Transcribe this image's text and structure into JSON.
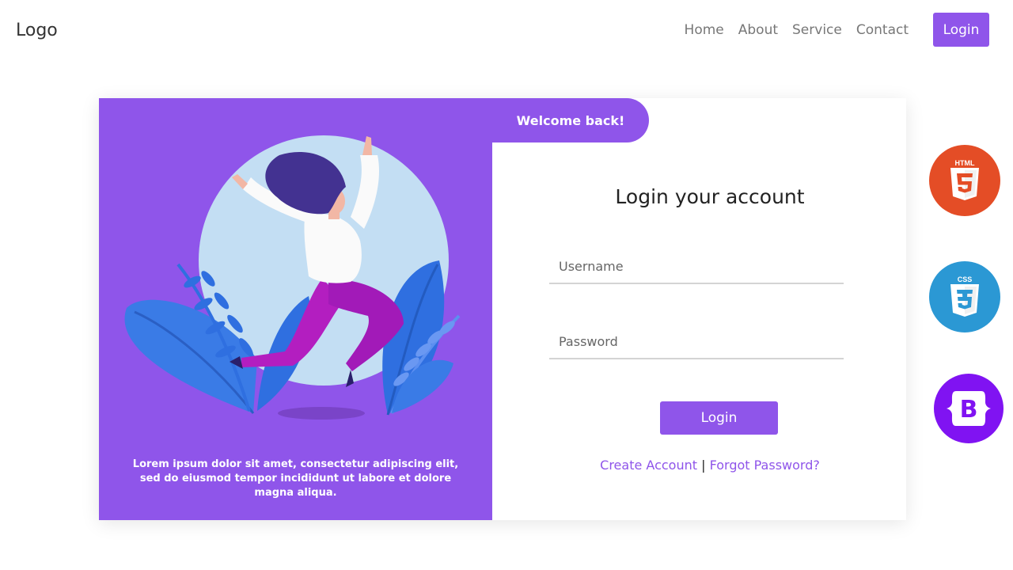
{
  "nav": {
    "logo": "Logo",
    "links": [
      "Home",
      "About",
      "Service",
      "Contact"
    ],
    "login_label": "Login"
  },
  "card": {
    "caption": "Lorem ipsum dolor sit amet, consectetur adipiscing elit, sed do eiusmod tempor incididunt ut labore et dolore magna aliqua.",
    "welcome": "Welcome back!",
    "title": "Login your account",
    "username_placeholder": "Username",
    "password_placeholder": "Password",
    "submit_label": "Login",
    "create_account": "Create Account",
    "separator": "|",
    "forgot_password": "Forgot Password?"
  },
  "badges": {
    "html": {
      "icon": "html5-icon",
      "label": "HTML"
    },
    "css": {
      "icon": "css3-icon",
      "label": "CSS"
    },
    "bootstrap": {
      "icon": "bootstrap-icon",
      "label": "B"
    }
  },
  "colors": {
    "accent": "#8f55ea",
    "html": "#e44d26",
    "css": "#2b98d4",
    "bootstrap": "#8013f2"
  }
}
